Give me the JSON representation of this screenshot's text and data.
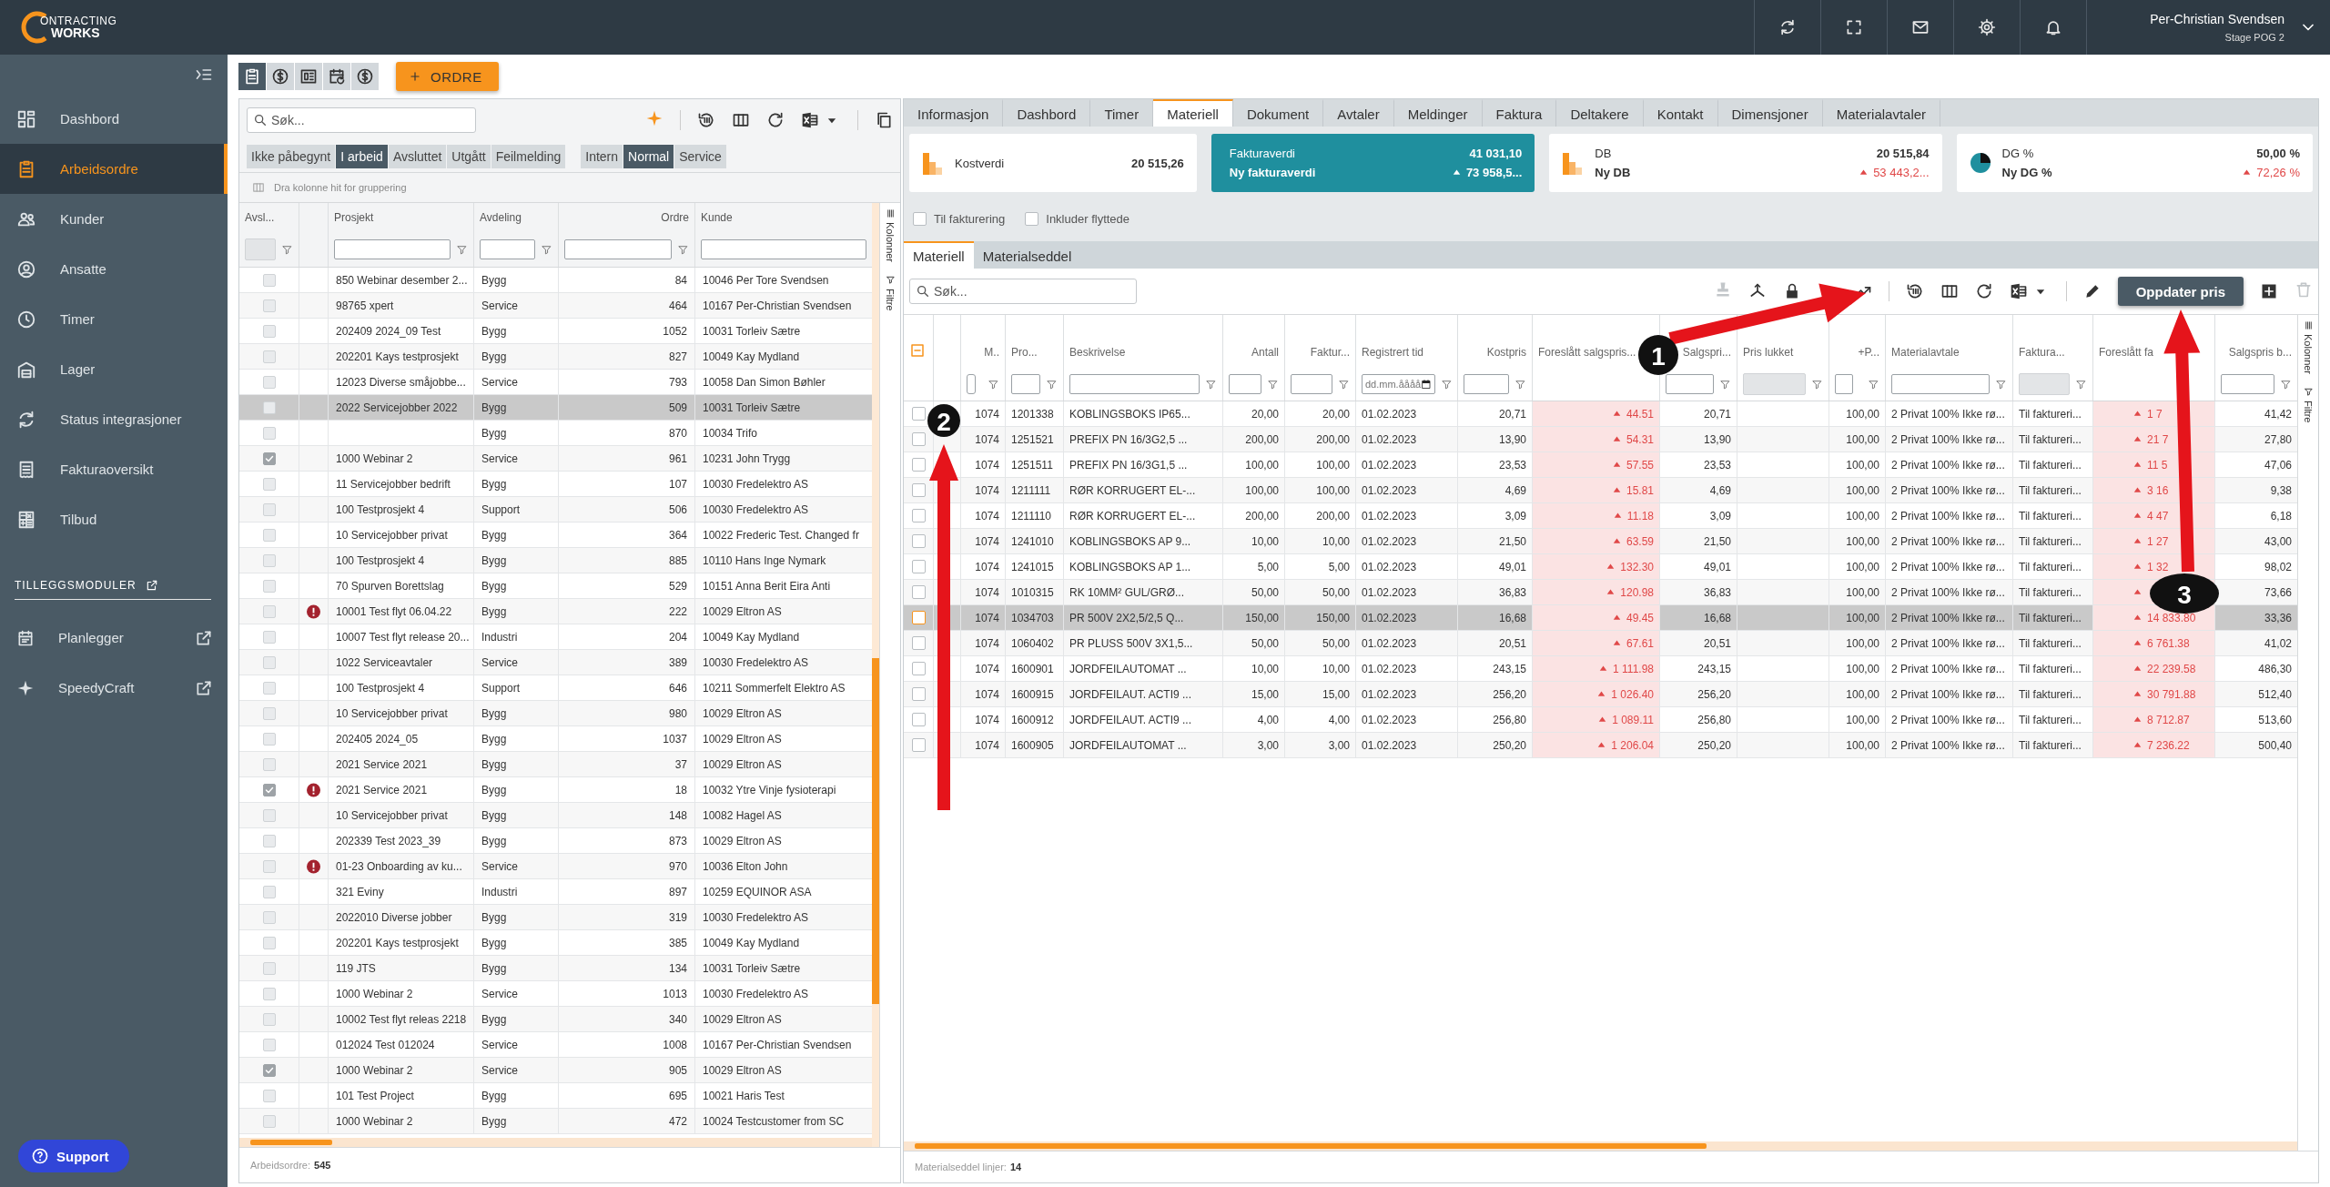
{
  "topbar": {
    "logo_top": "ONTRACTING",
    "logo_bottom": "WORKS",
    "user_name": "Per-Christian Svendsen",
    "user_role": "Stage POG 2"
  },
  "sidebar": {
    "items": [
      {
        "label": "Dashbord",
        "selected": false
      },
      {
        "label": "Arbeidsordre",
        "selected": true
      },
      {
        "label": "Kunder",
        "selected": false
      },
      {
        "label": "Ansatte",
        "selected": false
      },
      {
        "label": "Timer",
        "selected": false
      },
      {
        "label": "Lager",
        "selected": false
      },
      {
        "label": "Status integrasjoner",
        "selected": false
      },
      {
        "label": "Fakturaoversikt",
        "selected": false
      },
      {
        "label": "Tilbud",
        "selected": false
      }
    ],
    "section_title": "TILLEGGSMODULER",
    "modules": [
      {
        "label": "Planlegger"
      },
      {
        "label": "SpeedyCraft"
      }
    ],
    "support": "Support"
  },
  "order_toolbar": {
    "view_tabs": [
      {
        "selected": true
      },
      {
        "selected": false
      },
      {
        "selected": false
      },
      {
        "selected": false
      },
      {
        "selected": false
      }
    ],
    "new_order": "ORDRE"
  },
  "order_list": {
    "search_placeholder": "Søk...",
    "status_filters": [
      {
        "label": "Ikke påbegynt",
        "selected": false
      },
      {
        "label": "I arbeid",
        "selected": true
      },
      {
        "label": "Avsluttet",
        "selected": false
      },
      {
        "label": "Utgått",
        "selected": false
      },
      {
        "label": "Feilmelding",
        "selected": false
      }
    ],
    "type_filters": [
      {
        "label": "Intern",
        "selected": false
      },
      {
        "label": "Normal",
        "selected": true
      },
      {
        "label": "Service",
        "selected": false
      }
    ],
    "group_hint": "Dra kolonne hit for gruppering",
    "columns": [
      "Avsl...",
      "Prosjekt",
      "Avdeling",
      "Ordre",
      "Kunde"
    ],
    "side_tabs": [
      "Kolonner",
      "Filtre"
    ],
    "rows": [
      {
        "checked": false,
        "warning": false,
        "selected": false,
        "project": "850 Webinar desember 2...",
        "department": "Bygg",
        "order": "84",
        "customer": "10046 Per Tore Svendsen"
      },
      {
        "checked": false,
        "warning": false,
        "selected": false,
        "project": "98765 xpert",
        "department": "Service",
        "order": "464",
        "customer": "10167 Per-Christian Svendsen"
      },
      {
        "checked": false,
        "warning": false,
        "selected": false,
        "project": "202409 2024_09 Test",
        "department": "Bygg",
        "order": "1052",
        "customer": "10031 Torleiv Sætre"
      },
      {
        "checked": false,
        "warning": false,
        "selected": false,
        "project": "202201 Kays testprosjekt",
        "department": "Bygg",
        "order": "827",
        "customer": "10049 Kay Mydland"
      },
      {
        "checked": false,
        "warning": false,
        "selected": false,
        "project": "12023 Diverse småjobbe...",
        "department": "Service",
        "order": "793",
        "customer": "10058 Dan Simon Bøhler"
      },
      {
        "checked": false,
        "warning": false,
        "selected": true,
        "project": "2022 Servicejobber 2022",
        "department": "Bygg",
        "order": "509",
        "customer": "10031 Torleiv Sætre"
      },
      {
        "checked": false,
        "warning": false,
        "selected": false,
        "department": "Bygg",
        "order": "870",
        "customer": "10034 Trifo"
      },
      {
        "checked": true,
        "warning": false,
        "selected": false,
        "project": "1000 Webinar 2",
        "department": "Service",
        "order": "961",
        "customer": "10231 John Trygg"
      },
      {
        "checked": false,
        "warning": false,
        "selected": false,
        "project": "11 Servicejobber bedrift",
        "department": "Bygg",
        "order": "107",
        "customer": "10030 Fredelektro AS"
      },
      {
        "checked": false,
        "warning": false,
        "selected": false,
        "project": "100 Testprosjekt 4",
        "department": "Support",
        "order": "506",
        "customer": "10030 Fredelektro AS"
      },
      {
        "checked": false,
        "warning": false,
        "selected": false,
        "project": "10 Servicejobber privat",
        "department": "Bygg",
        "order": "364",
        "customer": "10022 Frederic Test. Changed fr"
      },
      {
        "checked": false,
        "warning": false,
        "selected": false,
        "project": "100 Testprosjekt 4",
        "department": "Bygg",
        "order": "885",
        "customer": "10110 Hans Inge Nymark"
      },
      {
        "checked": false,
        "warning": false,
        "selected": false,
        "project": "70 Spurven Borettslag",
        "department": "Bygg",
        "order": "529",
        "customer": "10151 Anna Berit Eira Anti"
      },
      {
        "checked": false,
        "warning": true,
        "selected": false,
        "project": "10001 Test flyt 06.04.22",
        "department": "Bygg",
        "order": "222",
        "customer": "10029 Eltron AS"
      },
      {
        "checked": false,
        "warning": false,
        "selected": false,
        "project": "10007 Test flyt release 20...",
        "department": "Industri",
        "order": "204",
        "customer": "10049 Kay Mydland"
      },
      {
        "checked": false,
        "warning": false,
        "selected": false,
        "project": "1022 Serviceavtaler",
        "department": "Service",
        "order": "389",
        "customer": "10030 Fredelektro AS"
      },
      {
        "checked": false,
        "warning": false,
        "selected": false,
        "project": "100 Testprosjekt 4",
        "department": "Support",
        "order": "646",
        "customer": "10211 Sommerfelt Elektro AS"
      },
      {
        "checked": false,
        "warning": false,
        "selected": false,
        "project": "10 Servicejobber privat",
        "department": "Bygg",
        "order": "980",
        "customer": "10029 Eltron AS"
      },
      {
        "checked": false,
        "warning": false,
        "selected": false,
        "project": "202405 2024_05",
        "department": "Bygg",
        "order": "1037",
        "customer": "10029 Eltron AS"
      },
      {
        "checked": false,
        "warning": false,
        "selected": false,
        "project": "2021 Service 2021",
        "department": "Bygg",
        "order": "37",
        "customer": "10029 Eltron AS"
      },
      {
        "checked": true,
        "warning": true,
        "selected": false,
        "project": "2021 Service 2021",
        "department": "Bygg",
        "order": "18",
        "customer": "10032 Ytre Vinje fysioterapi"
      },
      {
        "checked": false,
        "warning": false,
        "selected": false,
        "project": "10 Servicejobber privat",
        "department": "Bygg",
        "order": "148",
        "customer": "10082 Hagel AS"
      },
      {
        "checked": false,
        "warning": false,
        "selected": false,
        "project": "202339 Test 2023_39",
        "department": "Bygg",
        "order": "873",
        "customer": "10029 Eltron AS"
      },
      {
        "checked": false,
        "warning": true,
        "selected": false,
        "project": "01-23 Onboarding av ku...",
        "department": "Service",
        "order": "970",
        "customer": "10036 Elton John"
      },
      {
        "checked": false,
        "warning": false,
        "selected": false,
        "project": "321 Eviny",
        "department": "Industri",
        "order": "897",
        "customer": "10259 EQUINOR ASA"
      },
      {
        "checked": false,
        "warning": false,
        "selected": false,
        "project": "2022010 Diverse jobber",
        "department": "Bygg",
        "order": "319",
        "customer": "10030 Fredelektro AS"
      },
      {
        "checked": false,
        "warning": false,
        "selected": false,
        "project": "202201 Kays testprosjekt",
        "department": "Bygg",
        "order": "385",
        "customer": "10049 Kay Mydland"
      },
      {
        "checked": false,
        "warning": false,
        "selected": false,
        "project": "119 JTS",
        "department": "Bygg",
        "order": "134",
        "customer": "10031 Torleiv Sætre"
      },
      {
        "checked": false,
        "warning": false,
        "selected": false,
        "project": "1000 Webinar 2",
        "department": "Service",
        "order": "1013",
        "customer": "10030 Fredelektro AS"
      },
      {
        "checked": false,
        "warning": false,
        "selected": false,
        "project": "10002 Test flyt releas 2218",
        "department": "Bygg",
        "order": "340",
        "customer": "10029 Eltron AS"
      },
      {
        "checked": false,
        "warning": false,
        "selected": false,
        "project": "012024 Test 012024",
        "department": "Service",
        "order": "1008",
        "customer": "10167 Per-Christian Svendsen"
      },
      {
        "checked": true,
        "warning": false,
        "selected": false,
        "project": "1000 Webinar 2",
        "department": "Service",
        "order": "905",
        "customer": "10029 Eltron AS"
      },
      {
        "checked": false,
        "warning": false,
        "selected": false,
        "project": "101 Test Project",
        "department": "Bygg",
        "order": "695",
        "customer": "10021 Haris Test"
      },
      {
        "checked": false,
        "warning": false,
        "selected": false,
        "project": "1000 Webinar 2",
        "department": "Bygg",
        "order": "472",
        "customer": "10024 Testcustomer from SC"
      }
    ],
    "footer_label": "Arbeidsordre:",
    "footer_count": "545"
  },
  "detail": {
    "tabs": [
      {
        "label": "Informasjon",
        "selected": false
      },
      {
        "label": "Dashbord",
        "selected": false
      },
      {
        "label": "Timer",
        "selected": false
      },
      {
        "label": "Materiell",
        "selected": true
      },
      {
        "label": "Dokument",
        "selected": false
      },
      {
        "label": "Avtaler",
        "selected": false
      },
      {
        "label": "Meldinger",
        "selected": false
      },
      {
        "label": "Faktura",
        "selected": false
      },
      {
        "label": "Deltakere",
        "selected": false
      },
      {
        "label": "Kontakt",
        "selected": false
      },
      {
        "label": "Dimensjoner",
        "selected": false
      },
      {
        "label": "Materialavtaler",
        "selected": false
      }
    ],
    "cards": [
      {
        "kind": "plain",
        "label": "Kostverdi",
        "value": "20 515,26"
      },
      {
        "kind": "highlight",
        "label": "Fakturaverdi",
        "value": "41 031,10",
        "sub_label": "Ny fakturaverdi",
        "sub_value": "73 958,5..."
      },
      {
        "kind": "plain",
        "label": "DB",
        "value": "20 515,84",
        "sub_label": "Ny DB",
        "sub_value": "53 443,2..."
      },
      {
        "kind": "plain",
        "label": "DG %",
        "value": "50,00 %",
        "sub_label": "Ny DG %",
        "sub_value": "72,26 %"
      }
    ],
    "options": [
      {
        "label": "Til fakturering",
        "checked": false
      },
      {
        "label": "Inkluder flyttede",
        "checked": false
      }
    ],
    "subtabs": [
      {
        "label": "Materiell",
        "selected": true
      },
      {
        "label": "Materialseddel",
        "selected": false
      }
    ],
    "search_placeholder": "Søk...",
    "update_button": "Oppdater pris",
    "columns": [
      "M..",
      "Pro...",
      "Beskrivelse",
      "Antall",
      "Faktur...",
      "Registrert tid",
      "Kostpris",
      "Foreslått salgspris...",
      "Salgspri...",
      "Pris lukket",
      "+P...",
      "Materialavtale",
      "Faktura...",
      "Foreslått fa",
      "Salgspris b..."
    ],
    "date_placeholder": "dd.mm.åååå",
    "side_tabs": [
      "Kolonner",
      "Filtre"
    ],
    "rows": [
      {
        "selected": false,
        "m": "1074",
        "product": "1201338",
        "description": "KOBLINGSBOKS IP65...",
        "quantity": "20,00",
        "invoiced": "20,00",
        "registered": "01.02.2023",
        "cost": "20,71",
        "suggested_price": "44.51",
        "price": "20,71",
        "markup": "100,00",
        "agreement": "2 Privat 100% Ikke rø...",
        "invoice_status": "Til faktureri...",
        "suggested_invoice_price": "1 7",
        "sales_total": "41,42"
      },
      {
        "selected": false,
        "m": "1074",
        "product": "1251521",
        "description": "PREFIX PN 16/3G2,5 ...",
        "quantity": "200,00",
        "invoiced": "200,00",
        "registered": "01.02.2023",
        "cost": "13,90",
        "suggested_price": "54.31",
        "price": "13,90",
        "markup": "100,00",
        "agreement": "2 Privat 100% Ikke rø...",
        "invoice_status": "Til faktureri...",
        "suggested_invoice_price": "21 7",
        "sales_total": "27,80"
      },
      {
        "selected": false,
        "m": "1074",
        "product": "1251511",
        "description": "PREFIX PN 16/3G1,5 ...",
        "quantity": "100,00",
        "invoiced": "100,00",
        "registered": "01.02.2023",
        "cost": "23,53",
        "suggested_price": "57.55",
        "price": "23,53",
        "markup": "100,00",
        "agreement": "2 Privat 100% Ikke rø...",
        "invoice_status": "Til faktureri...",
        "suggested_invoice_price": "11 5",
        "sales_total": "47,06"
      },
      {
        "selected": false,
        "m": "1074",
        "product": "1211111",
        "description": "RØR KORRUGERT EL-...",
        "quantity": "100,00",
        "invoiced": "100,00",
        "registered": "01.02.2023",
        "cost": "4,69",
        "suggested_price": "15.81",
        "price": "4,69",
        "markup": "100,00",
        "agreement": "2 Privat 100% Ikke rø...",
        "invoice_status": "Til faktureri...",
        "suggested_invoice_price": "3 16",
        "sales_total": "9,38"
      },
      {
        "selected": false,
        "m": "1074",
        "product": "1211110",
        "description": "RØR KORRUGERT EL-...",
        "quantity": "200,00",
        "invoiced": "200,00",
        "registered": "01.02.2023",
        "cost": "3,09",
        "suggested_price": "11.18",
        "price": "3,09",
        "markup": "100,00",
        "agreement": "2 Privat 100% Ikke rø...",
        "invoice_status": "Til faktureri...",
        "suggested_invoice_price": "4 47",
        "sales_total": "6,18"
      },
      {
        "selected": false,
        "m": "1074",
        "product": "1241010",
        "description": "KOBLINGSBOKS AP 9...",
        "quantity": "10,00",
        "invoiced": "10,00",
        "registered": "01.02.2023",
        "cost": "21,50",
        "suggested_price": "63.59",
        "price": "21,50",
        "markup": "100,00",
        "agreement": "2 Privat 100% Ikke rø...",
        "invoice_status": "Til faktureri...",
        "suggested_invoice_price": "1 27",
        "sales_total": "43,00"
      },
      {
        "selected": false,
        "m": "1074",
        "product": "1241015",
        "description": "KOBLINGSBOKS AP 1...",
        "quantity": "5,00",
        "invoiced": "5,00",
        "registered": "01.02.2023",
        "cost": "49,01",
        "suggested_price": "132.30",
        "price": "49,01",
        "markup": "100,00",
        "agreement": "2 Privat 100% Ikke rø...",
        "invoice_status": "Til faktureri...",
        "suggested_invoice_price": "1 32",
        "sales_total": "98,02"
      },
      {
        "selected": false,
        "m": "1074",
        "product": "1010315",
        "description": "RK 10MM² GUL/GRØ...",
        "quantity": "50,00",
        "invoiced": "50,00",
        "registered": "01.02.2023",
        "cost": "36,83",
        "suggested_price": "120.98",
        "price": "36,83",
        "markup": "100,00",
        "agreement": "2 Privat 100% Ikke rø...",
        "invoice_status": "Til faktureri...",
        "sales_total": "73,66"
      },
      {
        "selected": true,
        "m": "1074",
        "product": "1034703",
        "description": "PR 500V 2X2,5/2,5 Q...",
        "quantity": "150,00",
        "invoiced": "150,00",
        "registered": "01.02.2023",
        "cost": "16,68",
        "suggested_price": "49.45",
        "price": "16,68",
        "markup": "100,00",
        "agreement": "2 Privat 100% Ikke rø...",
        "invoice_status": "Til faktureri...",
        "suggested_invoice_price": "14 833.80",
        "sales_total": "33,36"
      },
      {
        "selected": false,
        "m": "1074",
        "product": "1060402",
        "description": "PR PLUSS 500V 3X1,5...",
        "quantity": "50,00",
        "invoiced": "50,00",
        "registered": "01.02.2023",
        "cost": "20,51",
        "suggested_price": "67.61",
        "price": "20,51",
        "markup": "100,00",
        "agreement": "2 Privat 100% Ikke rø...",
        "invoice_status": "Til faktureri...",
        "suggested_invoice_price": "6 761.38",
        "sales_total": "41,02"
      },
      {
        "selected": false,
        "m": "1074",
        "product": "1600901",
        "description": "JORDFEILAUTOMAT ...",
        "quantity": "10,00",
        "invoiced": "10,00",
        "registered": "01.02.2023",
        "cost": "243,15",
        "suggested_price": "1 111.98",
        "price": "243,15",
        "markup": "100,00",
        "agreement": "2 Privat 100% Ikke rø...",
        "invoice_status": "Til faktureri...",
        "suggested_invoice_price": "22 239.58",
        "sales_total": "486,30"
      },
      {
        "selected": false,
        "m": "1074",
        "product": "1600915",
        "description": "JORDFEILAUT. ACTI9 ...",
        "quantity": "15,00",
        "invoiced": "15,00",
        "registered": "01.02.2023",
        "cost": "256,20",
        "suggested_price": "1 026.40",
        "price": "256,20",
        "markup": "100,00",
        "agreement": "2 Privat 100% Ikke rø...",
        "invoice_status": "Til faktureri...",
        "suggested_invoice_price": "30 791.88",
        "sales_total": "512,40"
      },
      {
        "selected": false,
        "m": "1074",
        "product": "1600912",
        "description": "JORDFEILAUT. ACTI9 ...",
        "quantity": "4,00",
        "invoiced": "4,00",
        "registered": "01.02.2023",
        "cost": "256,80",
        "suggested_price": "1 089.11",
        "price": "256,80",
        "markup": "100,00",
        "agreement": "2 Privat 100% Ikke rø...",
        "invoice_status": "Til faktureri...",
        "suggested_invoice_price": "8 712.87",
        "sales_total": "513,60"
      },
      {
        "selected": false,
        "m": "1074",
        "product": "1600905",
        "description": "JORDFEILAUTOMAT ...",
        "quantity": "3,00",
        "invoiced": "3,00",
        "registered": "01.02.2023",
        "cost": "250,20",
        "suggested_price": "1 206.04",
        "price": "250,20",
        "markup": "100,00",
        "agreement": "2 Privat 100% Ikke rø...",
        "invoice_status": "Til faktureri...",
        "suggested_invoice_price": "7 236.22",
        "sales_total": "500,40"
      }
    ],
    "footer_label": "Materialseddel linjer:",
    "footer_count": "14"
  },
  "annotations": [
    {
      "label": "1"
    },
    {
      "label": "2"
    },
    {
      "label": "3"
    }
  ]
}
